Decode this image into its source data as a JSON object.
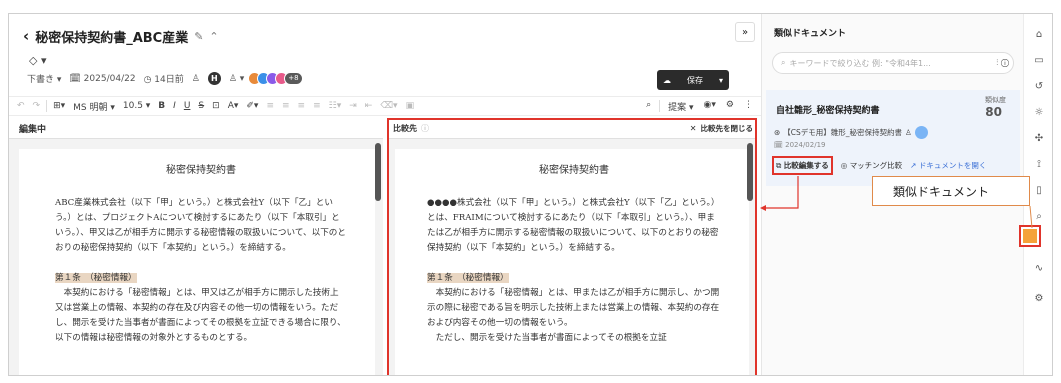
{
  "header": {
    "back_icon": "‹",
    "title": "秘密保持契約書_ABC産業",
    "meta_items": [
      "下書き ▾",
      "🗓 2025/04/22",
      "◷ 14日前",
      "♙",
      "♙ ▾"
    ],
    "avatar_initial": "H",
    "avatar_more": "+8",
    "tag_icon": "◇ ▾",
    "save_label": "保存",
    "collapse_label": "»"
  },
  "toolbar": {
    "font_name": "MS 明朝 ▾",
    "font_size": "10.5 ▾",
    "bold": "B",
    "italic": "I",
    "underline": "U",
    "strike": "S",
    "suggest": "提案 ▾"
  },
  "left_pane": {
    "label": "編集中",
    "title": "秘密保持契約書",
    "paragraphs": [
      "ABC産業株式会社（以下「甲」という。）と株式会社Y（以下「乙」という。）とは、プロジェクトAについて検討するにあたり（以下「本取引」という。）、甲又は乙が相手方に開示する秘密情報の取扱いについて、以下のとおりの秘密保持契約（以下「本契約」という。）を締結する。",
      "第１条　（秘密情報）",
      "　本契約における「秘密情報」とは、甲又は乙が相手方に開示した技術上又は営業上の情報、本契約の存在及び内容その他一切の情報をいう。ただし、開示を受けた当事者が書面によってその根拠を立証できる場合に限り、以下の情報は秘密情報の対象外とするものとする。"
    ]
  },
  "right_pane": {
    "label": "比較先",
    "close_label": "比較先を閉じる",
    "title": "秘密保持契約書",
    "paragraphs": [
      "●●●●株式会社（以下「甲」という。）と株式会社Y（以下「乙」という。）とは、FRAIMについて検討するにあたり（以下「本取引」という。）、甲または乙が相手方に開示する秘密情報の取扱いについて、以下のとおりの秘密保持契約（以下「本契約」という。）を締結する。",
      "第１条　（秘密情報）",
      "　本契約における「秘密情報」とは、甲または乙が相手方に開示し、かつ開示の際に秘密である旨を明示した技術上または営業上の情報、本契約の存在および内容その他一切の情報をいう。",
      "　ただし、開示を受けた当事者が書面によってその根拠を立証"
    ]
  },
  "similar": {
    "title": "類似ドキュメント",
    "search_placeholder": "キーワードで絞り込む 例: \"令和4年1...",
    "doc_name": "自社雛形_秘密保持契約書",
    "score_label": "類似度",
    "score": "80",
    "doc_meta": "【CSデモ用】雛形_秘密保持契約書",
    "date": "2024/02/19",
    "actions": [
      "比較編集する",
      "マッチング比較",
      "ドキュメントを開く"
    ]
  },
  "callout": {
    "text": "類似ドキュメント"
  },
  "colors": {
    "highlight_red": "#e0342b",
    "callout_border": "#e08a4a",
    "accent": "#f5a23a"
  }
}
